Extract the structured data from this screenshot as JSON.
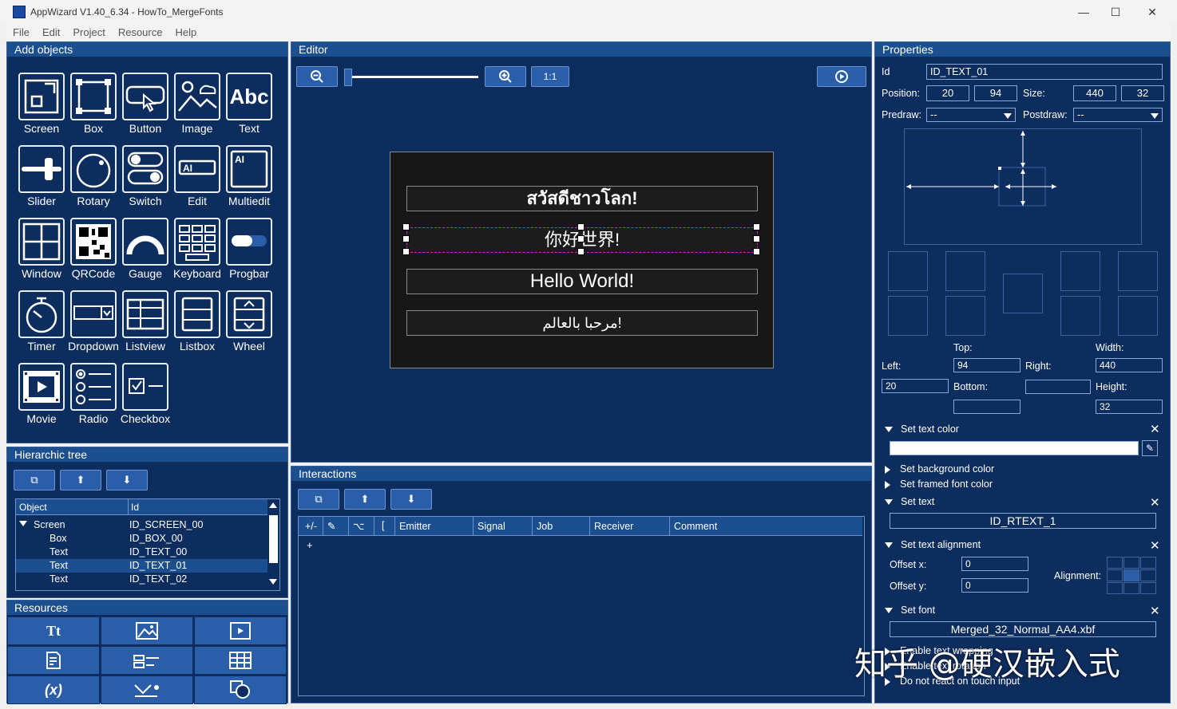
{
  "window": {
    "title": "AppWizard V1.40_6.34 - HowTo_MergeFonts",
    "min": "—",
    "max": "☐",
    "close": "✕"
  },
  "menu": [
    "File",
    "Edit",
    "Project",
    "Resource",
    "Help"
  ],
  "add_objects": {
    "title": "Add objects",
    "items": [
      "Screen",
      "Box",
      "Button",
      "Image",
      "Text",
      "Slider",
      "Rotary",
      "Switch",
      "Edit",
      "Multiedit",
      "Window",
      "QRCode",
      "Gauge",
      "Keyboard",
      "Progbar",
      "Timer",
      "Dropdown",
      "Listview",
      "Listbox",
      "Wheel",
      "Movie",
      "Radio",
      "Checkbox"
    ],
    "text_icon": "Abc"
  },
  "tree": {
    "title": "Hierarchic tree",
    "col_object": "Object",
    "col_id": "Id",
    "rows": [
      {
        "o": "Screen",
        "id": "ID_SCREEN_00"
      },
      {
        "o": "Box",
        "id": "ID_BOX_00"
      },
      {
        "o": "Text",
        "id": "ID_TEXT_00"
      },
      {
        "o": "Text",
        "id": "ID_TEXT_01"
      },
      {
        "o": "Text",
        "id": "ID_TEXT_02"
      }
    ]
  },
  "resources": {
    "title": "Resources",
    "text_icon": "Tt",
    "var_icon": "(x)"
  },
  "editor": {
    "title": "Editor",
    "zoom_reset": "1:1",
    "zoom_level": 0,
    "texts": [
      "สวัสดีชาวโลก!",
      "你好世界!",
      "Hello World!",
      "مرحبا بالعالم!"
    ]
  },
  "interactions": {
    "title": "Interactions",
    "cols": [
      "+/-",
      "",
      "",
      "[",
      "Emitter",
      "Signal",
      "Job",
      "Receiver",
      "Comment"
    ],
    "add": "+"
  },
  "properties": {
    "title": "Properties",
    "id_label": "Id",
    "id_value": "ID_TEXT_01",
    "position_label": "Position:",
    "pos_x": "20",
    "pos_y": "94",
    "size_label": "Size:",
    "size_w": "440",
    "size_h": "32",
    "predraw_label": "Predraw:",
    "predraw": "--",
    "postdraw_label": "Postdraw:",
    "postdraw": "--",
    "top_label": "Top:",
    "top": "94",
    "width_label": "Width:",
    "width": "440",
    "left_label": "Left:",
    "left": "20",
    "right_label": "Right:",
    "right": "",
    "bottom_label": "Bottom:",
    "bottom": "",
    "height_label": "Height:",
    "height": "32",
    "set_text_color": "Set text color",
    "set_bg_color": "Set background color",
    "set_framed": "Set framed font color",
    "set_text": "Set text",
    "text_id": "ID_RTEXT_1",
    "set_align": "Set text alignment",
    "offx_label": "Offset x:",
    "offx": "0",
    "offy_label": "Offset y:",
    "offy": "0",
    "align_label": "Alignment:",
    "set_font": "Set font",
    "font": "Merged_32_Normal_AA4.xbf",
    "wrap": "Enable text wrapping",
    "rot": "Enable text rotation",
    "touch": "Do not react on touch input"
  },
  "watermark": "知乎 @硬汉嵌入式"
}
